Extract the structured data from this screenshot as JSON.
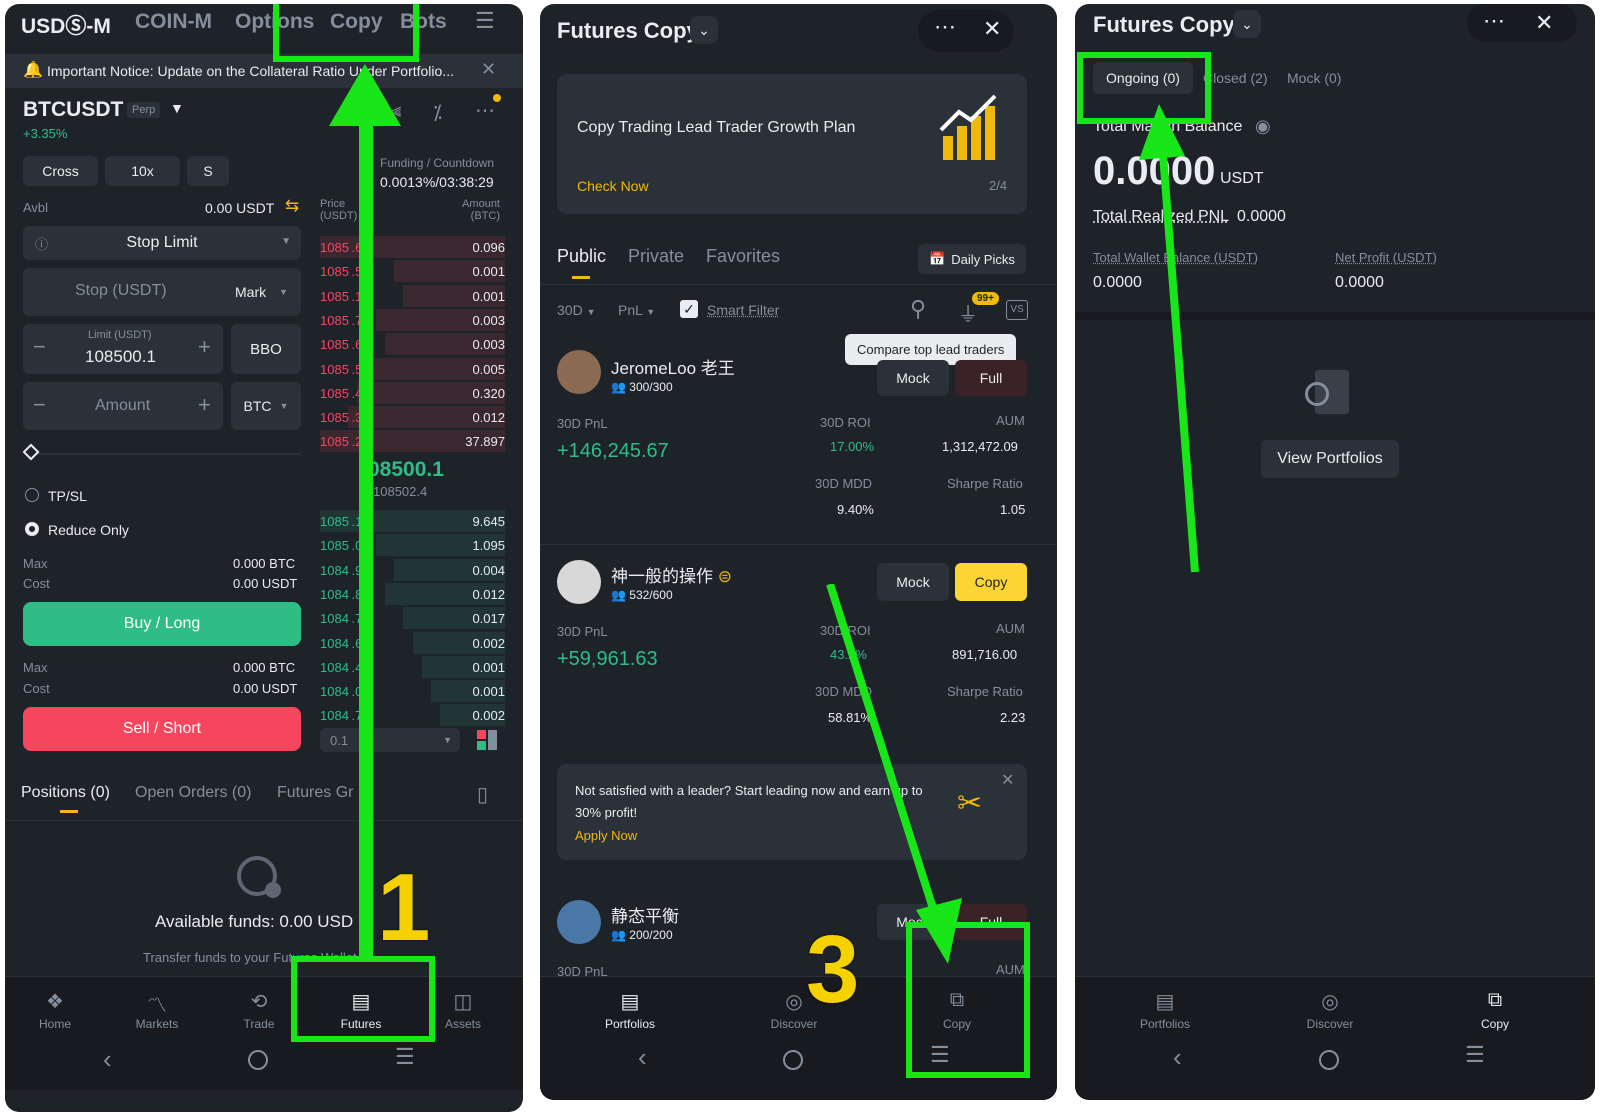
{
  "colors": {
    "bg": "#1e2329",
    "panel": "#2b3139",
    "green": "#2ebd85",
    "red": "#f6465d",
    "yellow": "#f0b90b",
    "highlight": "#19e619"
  },
  "p1": {
    "tabs": [
      "USDⓈ-M",
      "COIN-M",
      "Options",
      "Copy",
      "Bots"
    ],
    "notice": "Important Notice: Update on the Collateral Ratio Under Portfolio...",
    "symbol": "BTCUSDT",
    "perp": "Perp",
    "change": "+3.35%",
    "margin": [
      "Cross",
      "10x",
      "S"
    ],
    "funding_label": "Funding / Countdown",
    "funding_value": "0.0013%/03:38:29",
    "avbl_label": "Avbl",
    "avbl_value": "0.00 USDT",
    "order_type": "Stop Limit",
    "stop_placeholder": "Stop (USDT)",
    "mark": "Mark",
    "limit_label": "Limit (USDT)",
    "limit_value": "108500.1",
    "bbo": "BBO",
    "amount_placeholder": "Amount",
    "amount_unit": "BTC",
    "price_hdr": "Price (USDT)",
    "amount_hdr": "Amount (BTC)",
    "asks": [
      {
        "p": "1085 .6",
        "a": "0.096"
      },
      {
        "p": "1085 .5",
        "a": "0.001"
      },
      {
        "p": "1085 .1",
        "a": "0.001"
      },
      {
        "p": "1085 .7",
        "a": "0.003"
      },
      {
        "p": "1085 .6",
        "a": "0.003"
      },
      {
        "p": "1085 .5",
        "a": "0.005"
      },
      {
        "p": "1085 .4",
        "a": "0.320"
      },
      {
        "p": "1085 .3",
        "a": "0.012"
      },
      {
        "p": "1085 .2",
        "a": "37.897"
      }
    ],
    "last_price": "08500.1",
    "mark_price": "108502.4",
    "bids": [
      {
        "p": "1085 .1",
        "a": "9.645"
      },
      {
        "p": "1085 .0",
        "a": "1.095"
      },
      {
        "p": "1084 .9",
        "a": "0.004"
      },
      {
        "p": "1084 .8",
        "a": "0.012"
      },
      {
        "p": "1084 .7",
        "a": "0.017"
      },
      {
        "p": "1084 .6",
        "a": "0.002"
      },
      {
        "p": "1084 .4",
        "a": "0.001"
      },
      {
        "p": "1084 .0",
        "a": "0.001"
      },
      {
        "p": "1084 .7",
        "a": "0.002"
      }
    ],
    "depth": "0.1",
    "tpsl": "TP/SL",
    "reduce_only": "Reduce Only",
    "max_label": "Max",
    "cost_label": "Cost",
    "buy_max": "0.000 BTC",
    "buy_cost": "0.00 USDT",
    "buy": "Buy / Long",
    "sell_max": "0.000 BTC",
    "sell_cost": "0.00 USDT",
    "sell": "Sell / Short",
    "pos_tabs": [
      "Positions (0)",
      "Open Orders (0)",
      "Futures Gr"
    ],
    "avail": "Available funds: 0.00 USD",
    "transfer": "Transfer funds to your Futures Wallet",
    "nav": [
      "Home",
      "Markets",
      "Trade",
      "Futures",
      "Assets"
    ],
    "step": "1"
  },
  "p2": {
    "title": "Futures Copy",
    "banner_title": "Copy Trading Lead Trader Growth Plan",
    "banner_link": "Check Now",
    "banner_page": "2/4",
    "tabs": [
      "Public",
      "Private",
      "Favorites"
    ],
    "daily": "Daily Picks",
    "filters": [
      "30D",
      "PnL"
    ],
    "smart": "Smart Filter",
    "badge": "99+",
    "vs": "VS",
    "tooltip": "Compare top lead traders",
    "traders": [
      {
        "name": "JeromeLoo 老王",
        "cap": "300/300",
        "pnl_label": "30D PnL",
        "pnl": "+146,245.67",
        "roi_label": "30D ROI",
        "roi": "17.00%",
        "aum_label": "AUM",
        "aum": "1,312,472.09",
        "mdd_label": "30D MDD",
        "mdd": "9.40%",
        "sharpe_label": "Sharpe Ratio",
        "sharpe": "1.05",
        "mock": "Mock",
        "action": "Full"
      },
      {
        "name": "神一般的操作",
        "cap": "532/600",
        "pnl_label": "30D PnL",
        "pnl": "+59,961.63",
        "roi_label": "30D ROI",
        "roi": "43.2%",
        "aum_label": "AUM",
        "aum": "891,716.00",
        "mdd_label": "30D MDD",
        "mdd": "58.81%",
        "sharpe_label": "Sharpe Ratio",
        "sharpe": "2.23",
        "mock": "Mock",
        "action": "Copy"
      },
      {
        "name": "静态平衡",
        "cap": "200/200",
        "pnl_label": "30D PnL",
        "aum_label": "AUM",
        "mock": "Mock",
        "action": "Full"
      }
    ],
    "promo": "Not satisfied with a leader? Start leading now and earn up to 30% profit!",
    "promo_link": "Apply Now",
    "nav": [
      "Portfolios",
      "Discover",
      "Copy"
    ],
    "step": "3"
  },
  "p3": {
    "title": "Futures Copy",
    "tabs": [
      "Ongoing (0)",
      "Closed (2)",
      "Mock (0)"
    ],
    "tmb_label": "Total Margin Balance",
    "tmb": "0.0000",
    "unit": "USDT",
    "realized_label": "Total Realized PNL",
    "realized": "0.0000",
    "wallet_label": "Total Wallet Balance (USDT)",
    "wallet": "0.0000",
    "profit_label": "Net Profit (USDT)",
    "profit": "0.0000",
    "view": "View Portfolios",
    "nav": [
      "Portfolios",
      "Discover",
      "Copy"
    ]
  }
}
